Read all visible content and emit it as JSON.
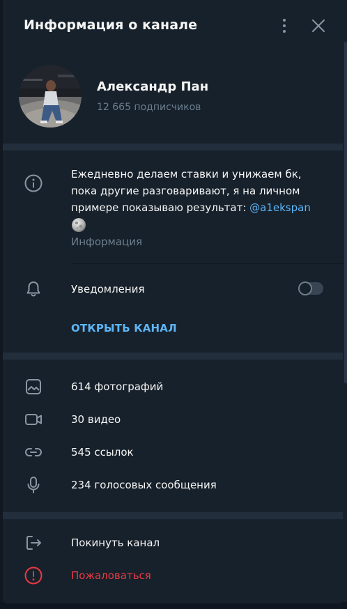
{
  "header": {
    "title": "Информация о канале",
    "menu_icon": "more-vertical-icon",
    "close_icon": "close-icon"
  },
  "profile": {
    "name": "Александр Пан",
    "subscribers": "12 665 подписчиков"
  },
  "about": {
    "text": "Ежедневно делаем ставки и унижаем бк, пока другие разговаривают, я на личном примере показываю результат: ",
    "link": "@a1ekspan",
    "label": "Информация"
  },
  "notifications": {
    "label": "Уведомления",
    "enabled": false
  },
  "open_channel": {
    "label": "ОТКРЫТЬ КАНАЛ"
  },
  "media": [
    {
      "icon": "photo-icon",
      "label": "614 фотографий"
    },
    {
      "icon": "video-icon",
      "label": "30 видео"
    },
    {
      "icon": "link-icon",
      "label": "545 ссылок"
    },
    {
      "icon": "microphone-icon",
      "label": "234 голосовых сообщения"
    }
  ],
  "actions": {
    "leave": "Покинуть канал",
    "report": "Пожаловаться"
  },
  "colors": {
    "accent": "#5eb5f7",
    "danger": "#ec3942",
    "panel": "#17212b",
    "separator": "#232e3c"
  }
}
